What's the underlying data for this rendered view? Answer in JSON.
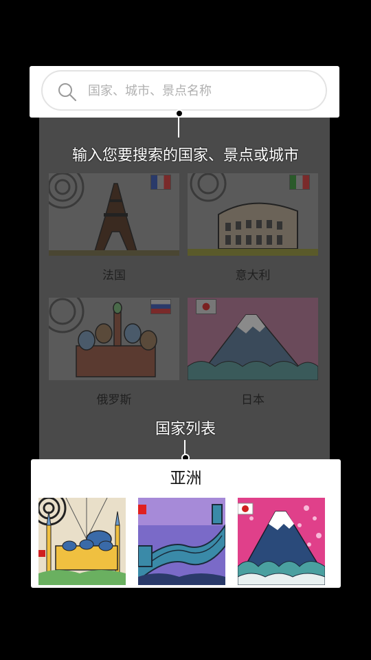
{
  "search": {
    "placeholder": "国家、城市、景点名称"
  },
  "tips": {
    "search_tip": "输入您要搜索的国家、景点或城市",
    "country_list_tip": "国家列表"
  },
  "countries": [
    {
      "label": "法国"
    },
    {
      "label": "意大利"
    },
    {
      "label": "俄罗斯"
    },
    {
      "label": "日本"
    }
  ],
  "asia": {
    "title": "亚洲"
  },
  "colors": {
    "overlay": "#4a4a4a",
    "panel": "#ffffff",
    "background": "#000000",
    "placeholder": "#b0b0b0"
  }
}
